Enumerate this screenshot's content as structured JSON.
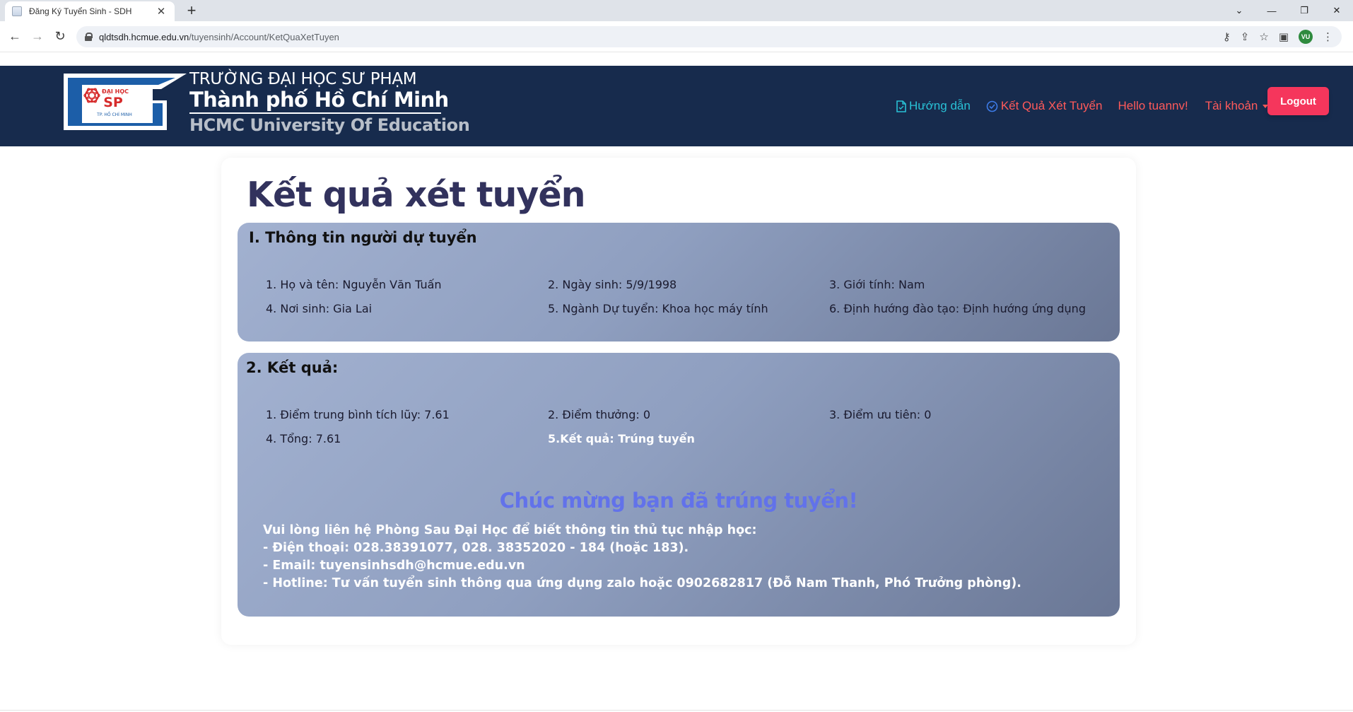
{
  "browser": {
    "tab_title": "Đăng Ký Tuyển Sinh - SDH",
    "url_host": "qldtsdh.hcmue.edu.vn",
    "url_path": "/tuyensinh/Account/KetQuaXetTuyen",
    "profile_initials": "VU",
    "profile_color": "#2e8a3e"
  },
  "header": {
    "logo_small_1": "ĐẠI HỌC",
    "logo_small_2": "SP",
    "logo_small_3": "TP. HỒ CHÍ MINH",
    "title_line1": "TRƯỜNG ĐẠI HỌC SƯ PHẠM",
    "title_line2": "Thành phố Hồ Chí Minh",
    "title_line3": "HCMC University Of Education",
    "nav": {
      "guide": "Hướng dẫn",
      "results": "Kết Quả Xét Tuyển",
      "hello": "Hello tuannv!",
      "account": "Tài khoản"
    },
    "logout_label": "Logout",
    "colors": {
      "bg": "#172b4d",
      "guide": "#29c1d6",
      "link": "#ff5a5a",
      "logout": "#f5365c"
    }
  },
  "main": {
    "page_title": "Kết quả xét tuyển",
    "section1": {
      "heading": "I. Thông tin người dự tuyển",
      "fields": [
        "1. Họ và tên: Nguyễn Văn Tuấn",
        "2. Ngày sinh: 5/9/1998",
        "3. Giới tính: Nam",
        "4. Nơi sinh: Gia Lai",
        "5. Ngành Dự tuyển: Khoa học máy tính",
        "6. Định hướng đào tạo: Định hướng ứng dụng"
      ]
    },
    "section2": {
      "heading": "2. Kết quả:",
      "fields": [
        "1. Điểm trung bình tích lũy: 7.61",
        "2. Điểm thưởng: 0",
        "3. Điểm ưu tiên: 0",
        "4. Tổng: 7.61",
        "5.Kết quả: Trúng tuyển"
      ],
      "congrats": "Chúc mừng bạn đã trúng tuyển!",
      "contact": [
        "Vui lòng liên hệ Phòng Sau Đại Học để biết thông tin thủ tục nhập học:",
        "- Điện thoại: 028.38391077, 028. 38352020 - 184 (hoặc 183).",
        "- Email: tuyensinhsdh@hcmue.edu.vn",
        "- Hotline: Tư vấn tuyển sinh thông qua ứng dụng zalo hoặc 0902682817 (Đỗ Nam Thanh, Phó Trưởng phòng)."
      ]
    }
  }
}
